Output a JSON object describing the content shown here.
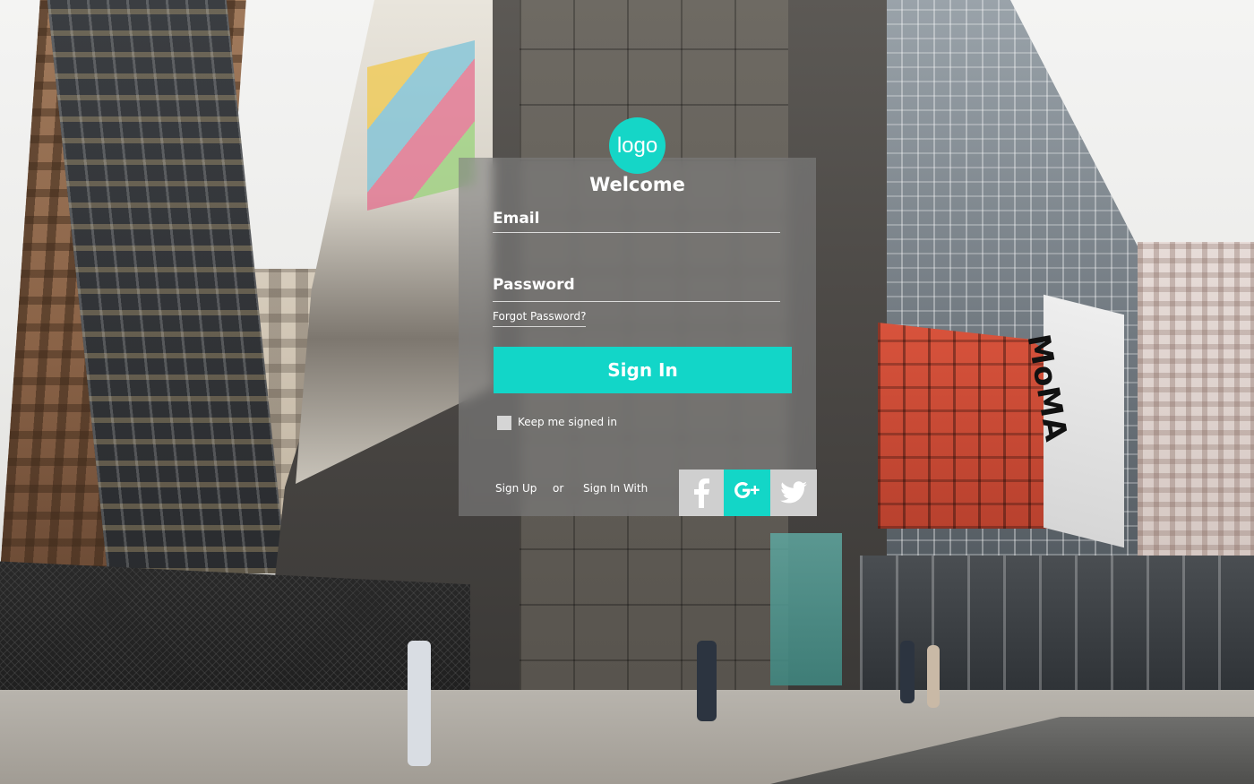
{
  "brand": {
    "logo_text": "logo",
    "accent_color": "#13D6C7"
  },
  "login": {
    "welcome": "Welcome",
    "email_label": "Email",
    "email_value": "",
    "password_label": "Password",
    "password_value": "",
    "forgot_password": "Forgot Password?",
    "sign_in_button": "Sign In",
    "keep_signed_in": "Keep me signed in",
    "keep_signed_in_checked": false,
    "sign_up_link": "Sign Up",
    "or_text": "or",
    "sign_in_with_text": "Sign In With"
  },
  "social": [
    {
      "name": "facebook-icon",
      "color": "#CFCFCF"
    },
    {
      "name": "google-plus-icon",
      "color": "#13D6C7"
    },
    {
      "name": "twitter-icon",
      "color": "#CFCFCF"
    }
  ],
  "background": {
    "sign_text": "MoMA"
  }
}
